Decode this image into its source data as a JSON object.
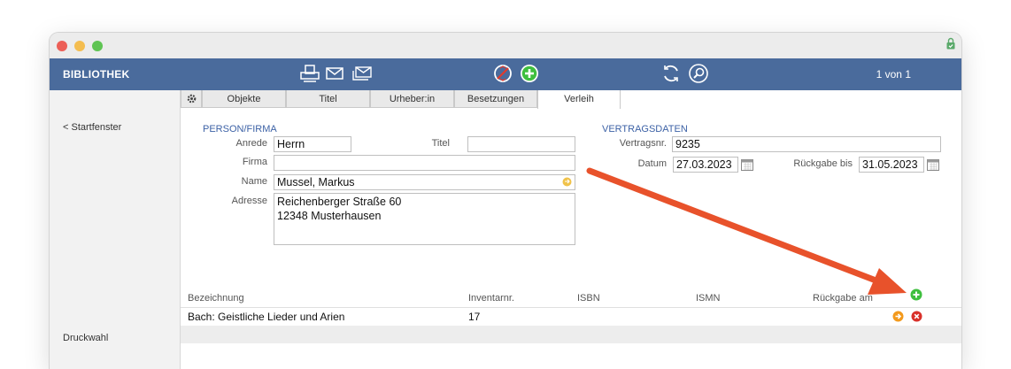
{
  "toolbar": {
    "app_title": "BIBLIOTHEK",
    "pager": "1 von 1"
  },
  "sidebar": {
    "back_label": "< Startfenster",
    "print_label": "Druckwahl"
  },
  "tabs": [
    "Objekte",
    "Titel",
    "Urheber:in",
    "Besetzungen",
    "Verleih"
  ],
  "person": {
    "section_title": "PERSON/FIRMA",
    "anrede_label": "Anrede",
    "anrede": "Herrn",
    "titel_label": "Titel",
    "titel": "",
    "firma_label": "Firma",
    "firma": "",
    "name_label": "Name",
    "name": "Mussel, Markus",
    "adresse_label": "Adresse",
    "adresse": "Reichenberger Straße 60\n12348 Musterhausen"
  },
  "contract": {
    "section_title": "VERTRAGSDATEN",
    "nr_label": "Vertragsnr.",
    "nr": "9235",
    "datum_label": "Datum",
    "datum": "27.03.2023",
    "rueckgabe_label": "Rückgabe bis",
    "rueckgabe": "31.05.2023"
  },
  "table": {
    "columns": [
      "Bezeichnung",
      "Inventarnr.",
      "ISBN",
      "ISMN",
      "Rückgabe am"
    ],
    "rows": [
      {
        "bezeichnung": "Bach: Geistliche Lieder und Arien",
        "inventarnr": "17",
        "isbn": "",
        "ismn": "",
        "rueckgabe": ""
      }
    ]
  },
  "icons": {
    "toolbar": [
      "printer-icon",
      "mail-icon",
      "mail-multiple-icon",
      "delete-record-icon",
      "add-record-icon",
      "refresh-icon",
      "search-icon"
    ],
    "row_actions": [
      "go-arrow-icon",
      "remove-icon"
    ],
    "add": "add-row-icon",
    "lock": "lock-icon",
    "settings": "gear-icon"
  },
  "colors": {
    "toolbar": "#4a6b9c",
    "section": "#3d62a6",
    "add_green": "#3fbf3f",
    "remove_red": "#d9312a",
    "go_orange": "#f39a1d",
    "annotation_arrow": "#e8522b"
  }
}
